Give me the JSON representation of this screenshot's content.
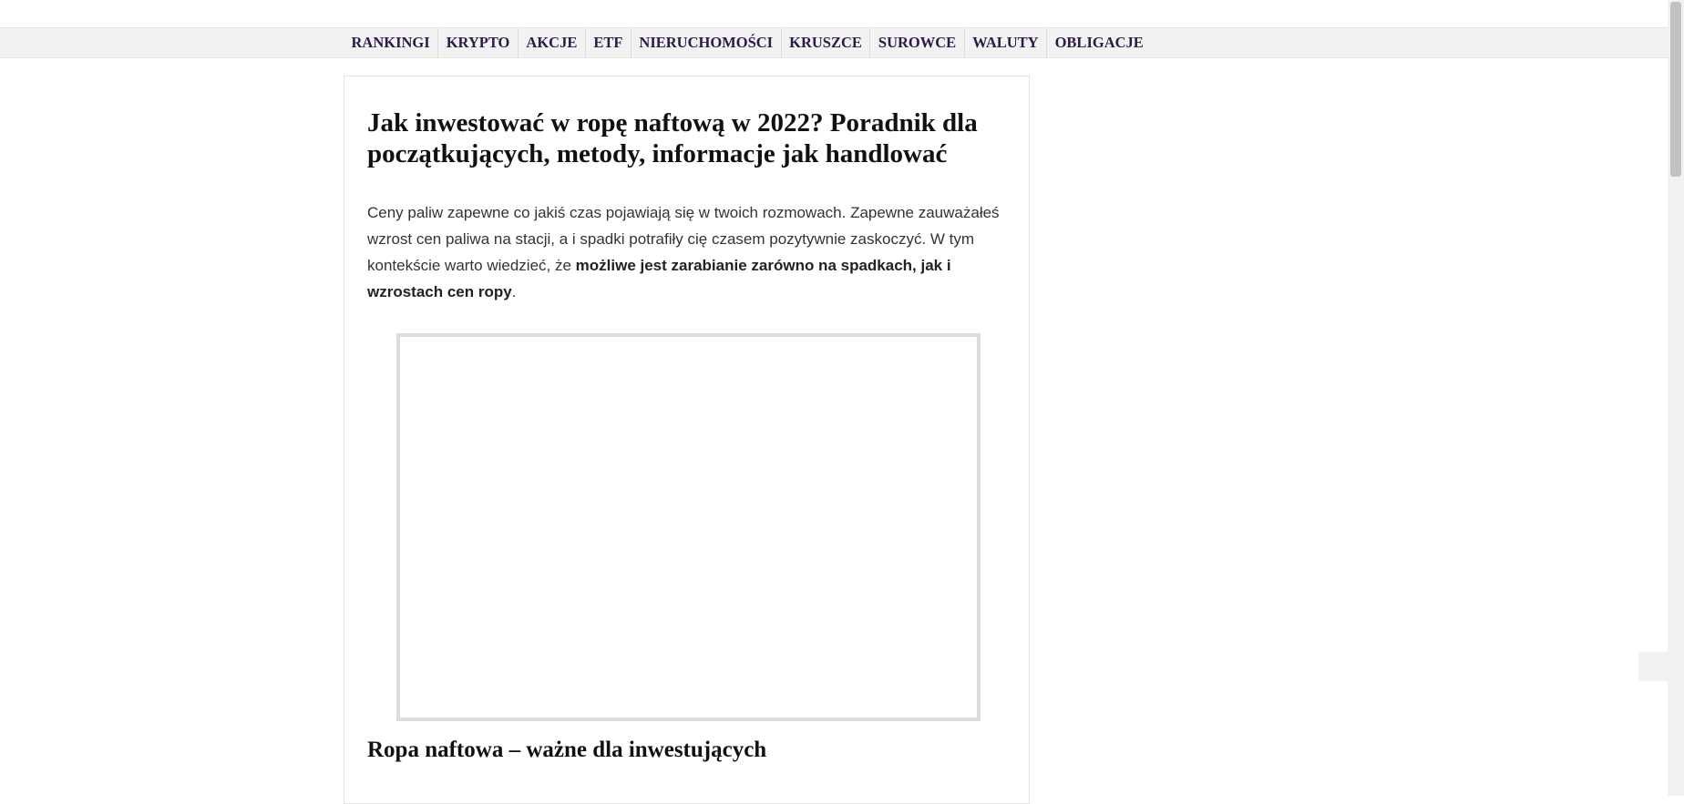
{
  "nav": {
    "items": [
      {
        "label": "RANKINGI"
      },
      {
        "label": "KRYPTO"
      },
      {
        "label": "AKCJE"
      },
      {
        "label": "ETF"
      },
      {
        "label": "NIERUCHOMOŚCI"
      },
      {
        "label": "KRUSZCE"
      },
      {
        "label": "SUROWCE"
      },
      {
        "label": "WALUTY"
      },
      {
        "label": "OBLIGACJE"
      }
    ]
  },
  "article": {
    "title": "Jak inwestować w ropę naftową w 2022? Poradnik dla początkujących, metody, informacje jak handlować",
    "intro_part1": "Ceny paliw zapewne co jakiś czas pojawiają się w twoich rozmowach. Zapewne zauważałeś wzrost cen paliwa na stacji, a i spadki potrafiły cię czasem pozytywnie zaskoczyć. W tym kontekście warto wiedzieć, że ",
    "intro_bold": "możliwe jest zarabianie zarówno na spadkach, jak i wzrostach cen ropy",
    "intro_end": ".",
    "section_heading": "Ropa naftowa – ważne dla inwestujących"
  },
  "colors": {
    "nav_text": "#2e1a47",
    "nav_bg": "#f2f2f2",
    "heading_text": "#111111",
    "body_text": "#333333",
    "frame_border": "#dcdcdc"
  }
}
